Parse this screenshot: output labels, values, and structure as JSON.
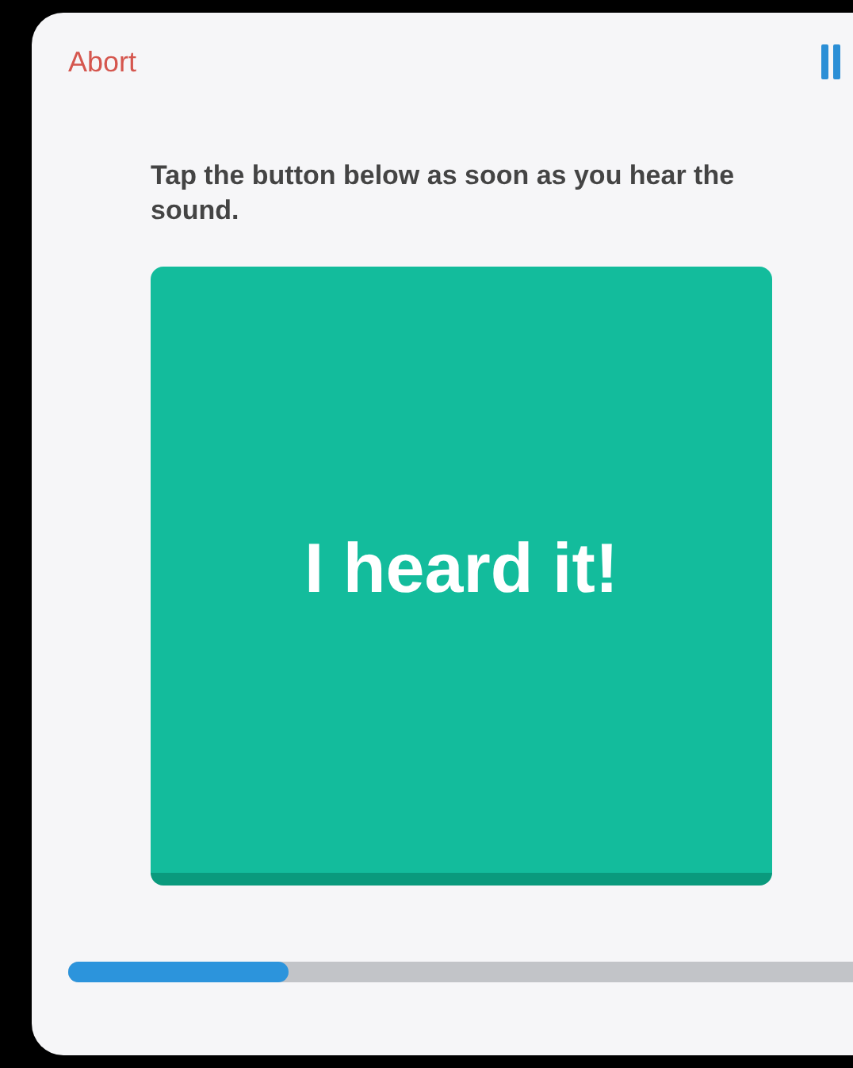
{
  "header": {
    "abort_label": "Abort"
  },
  "instruction": "Tap the button below as soon as you hear the sound.",
  "response_button": {
    "label": "I heard it!"
  },
  "progress": {
    "level": 0.28
  }
}
